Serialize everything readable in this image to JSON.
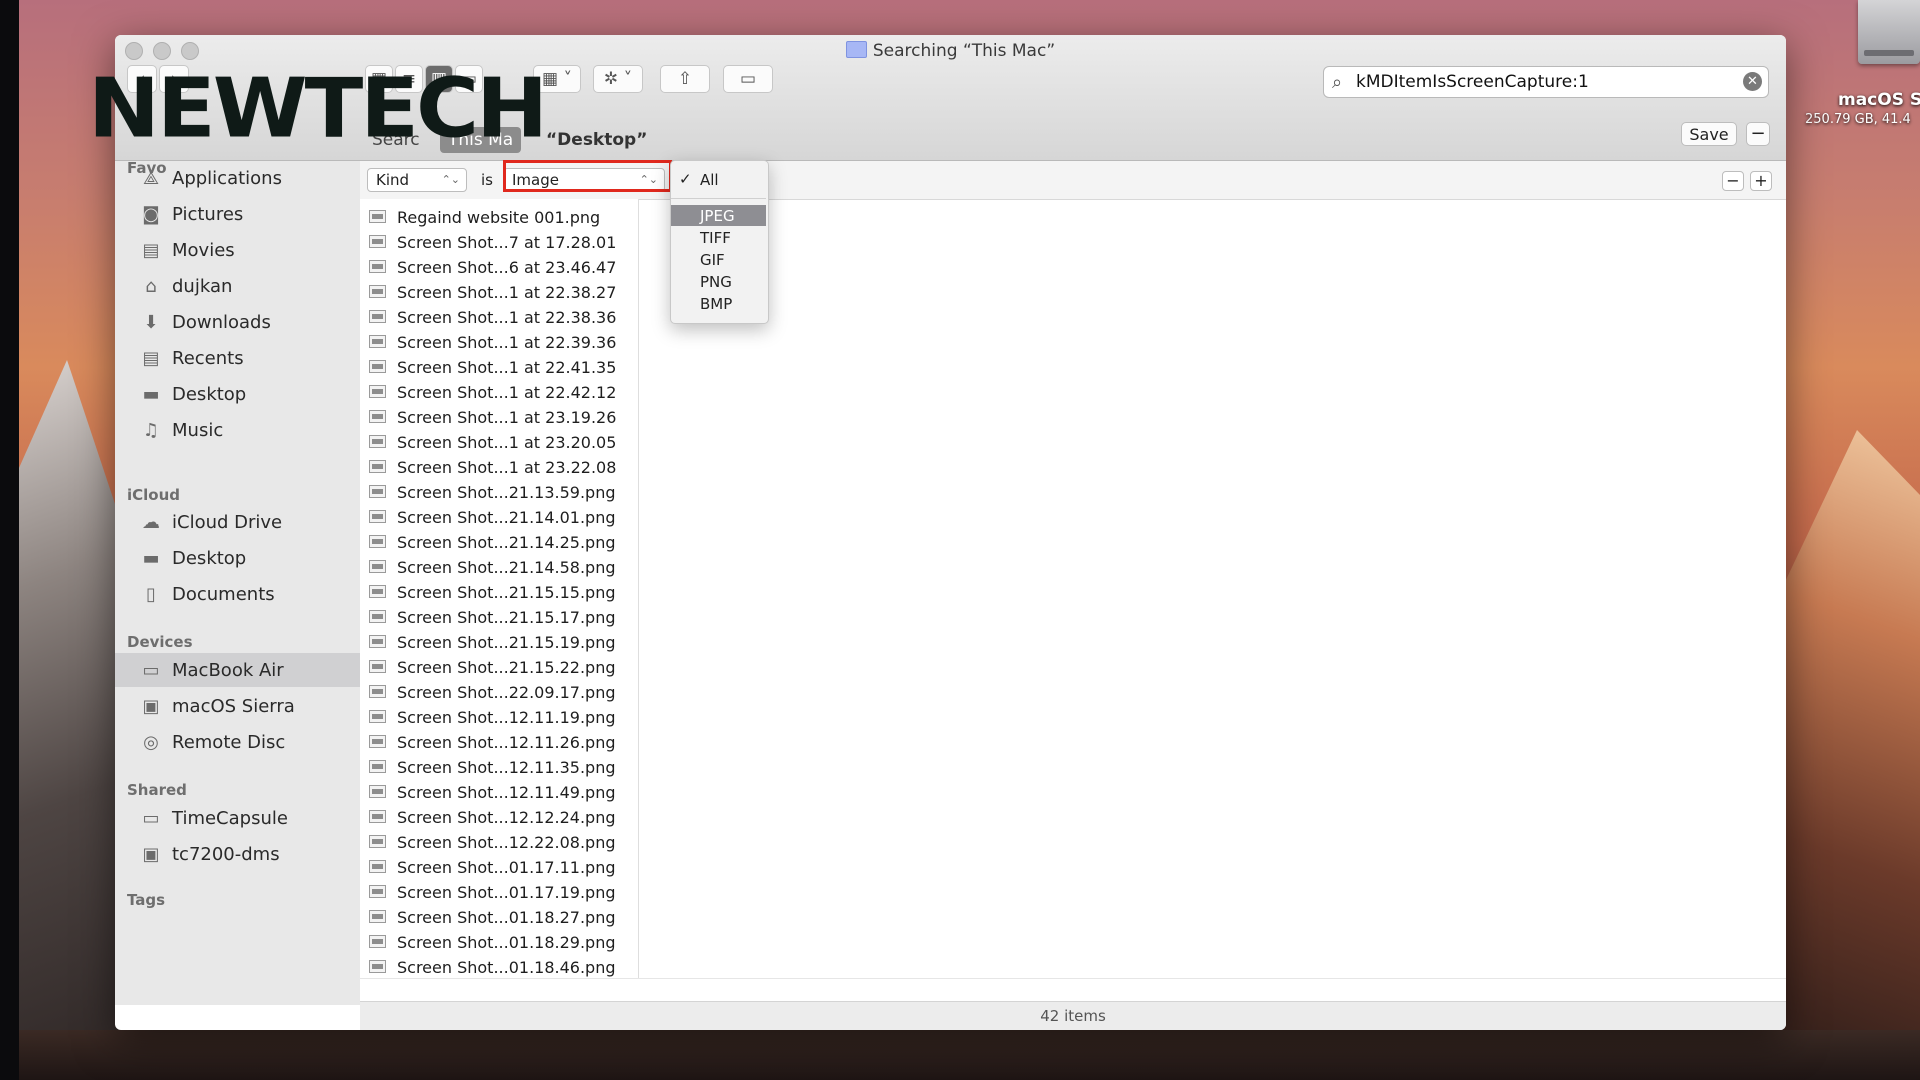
{
  "window": {
    "title": "Searching “This Mac”"
  },
  "desktop": {
    "disk_label": "macOS Si",
    "disk_sub": "250.79 GB, 41.4"
  },
  "watermark": {
    "text": "NEWTECH"
  },
  "toolbar": {
    "back_icon": "chevron-left-icon",
    "forward_icon": "chevron-right-icon",
    "view_icons": [
      "icon-view-icon",
      "list-view-icon",
      "column-view-icon",
      "gallery-view-icon"
    ],
    "arrange_icon": "arrange-grid-icon",
    "action_icon": "gear-icon",
    "share_icon": "share-icon",
    "tag_icon": "tag-icon"
  },
  "search": {
    "query": "kMDItemIsScreenCapture:1"
  },
  "scope": {
    "search_label": "Searc",
    "this_mac": "This Ma",
    "desktop": "“Desktop”",
    "save": "Save",
    "remove": "−"
  },
  "sidebar": {
    "favorites_header": "Favo",
    "favorites": [
      {
        "label": "Applications",
        "icon": "applications-icon"
      },
      {
        "label": "Pictures",
        "icon": "pictures-icon"
      },
      {
        "label": "Movies",
        "icon": "movies-icon"
      },
      {
        "label": "dujkan",
        "icon": "home-icon"
      },
      {
        "label": "Downloads",
        "icon": "downloads-icon"
      },
      {
        "label": "Recents",
        "icon": "recents-icon"
      },
      {
        "label": "Desktop",
        "icon": "desktop-icon"
      },
      {
        "label": "Music",
        "icon": "music-icon"
      }
    ],
    "icloud_header": "iCloud",
    "icloud": [
      {
        "label": "iCloud Drive",
        "icon": "cloud-icon"
      },
      {
        "label": "Desktop",
        "icon": "desktop-icon"
      },
      {
        "label": "Documents",
        "icon": "documents-icon"
      }
    ],
    "devices_header": "Devices",
    "devices": [
      {
        "label": "MacBook Air",
        "icon": "laptop-icon"
      },
      {
        "label": "macOS Sierra",
        "icon": "disk-icon"
      },
      {
        "label": "Remote Disc",
        "icon": "disc-icon"
      }
    ],
    "shared_header": "Shared",
    "shared": [
      {
        "label": "TimeCapsule",
        "icon": "timecapsule-icon"
      },
      {
        "label": "tc7200-dms",
        "icon": "monitor-icon"
      }
    ],
    "tags_header": "Tags"
  },
  "filter": {
    "attribute": "Kind",
    "operator": "is",
    "value": "Image",
    "minus": "−",
    "plus": "+",
    "menu_items": [
      "All",
      "JPEG",
      "TIFF",
      "GIF",
      "PNG",
      "BMP"
    ],
    "checked_item": "All",
    "highlighted_item": "JPEG"
  },
  "files": [
    "Regaind website 001.png",
    "Screen Shot...7 at 17.28.01",
    "Screen Shot...6 at 23.46.47",
    "Screen Shot...1 at 22.38.27",
    "Screen Shot...1 at 22.38.36",
    "Screen Shot...1 at 22.39.36",
    "Screen Shot...1 at 22.41.35",
    "Screen Shot...1 at 22.42.12",
    "Screen Shot...1 at 23.19.26",
    "Screen Shot...1 at 23.20.05",
    "Screen Shot...1 at 23.22.08",
    "Screen Shot...21.13.59.png",
    "Screen Shot...21.14.01.png",
    "Screen Shot...21.14.25.png",
    "Screen Shot...21.14.58.png",
    "Screen Shot...21.15.15.png",
    "Screen Shot...21.15.17.png",
    "Screen Shot...21.15.19.png",
    "Screen Shot...21.15.22.png",
    "Screen Shot...22.09.17.png",
    "Screen Shot...12.11.19.png",
    "Screen Shot...12.11.26.png",
    "Screen Shot...12.11.35.png",
    "Screen Shot...12.11.49.png",
    "Screen Shot...12.12.24.png",
    "Screen Shot...12.22.08.png",
    "Screen Shot...01.17.11.png",
    "Screen Shot...01.17.19.png",
    "Screen Shot...01.18.27.png",
    "Screen Shot...01.18.29.png",
    "Screen Shot...01.18.46.png"
  ],
  "status": {
    "items": "42 items"
  },
  "colors": {
    "highlight_box": "#e0281d",
    "menu_selection": "#8e8e93",
    "sidebar_selection": "#d0d0d2"
  }
}
